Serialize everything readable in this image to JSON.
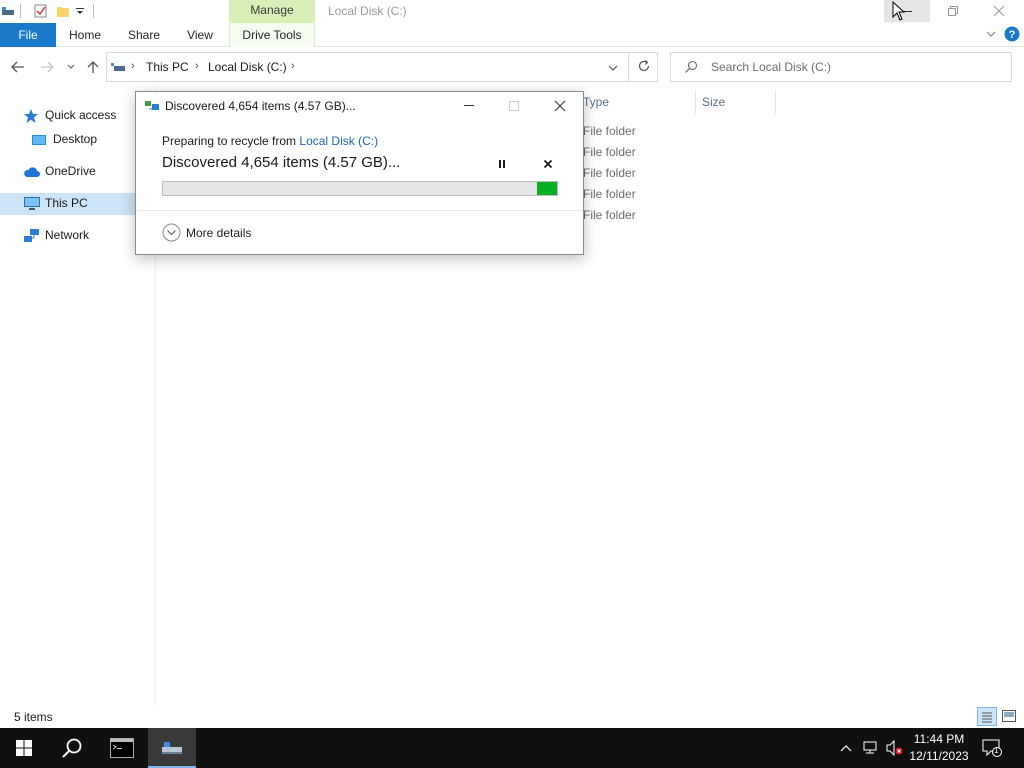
{
  "window": {
    "title": "Local Disk (C:)"
  },
  "ribbon": {
    "context_group": "Manage",
    "tabs": [
      {
        "label": "File"
      },
      {
        "label": "Home"
      },
      {
        "label": "Share"
      },
      {
        "label": "View"
      },
      {
        "label": "Drive Tools"
      }
    ]
  },
  "address": {
    "breadcrumb": [
      "This PC",
      "Local Disk (C:)"
    ],
    "search_placeholder": "Search Local Disk (C:)"
  },
  "nav": {
    "items": [
      {
        "label": "Quick access",
        "icon": "star-icon"
      },
      {
        "label": "Desktop",
        "icon": "desktop-folder-icon"
      },
      {
        "label": "OneDrive",
        "icon": "cloud-icon"
      },
      {
        "label": "This PC",
        "icon": "computer-icon",
        "selected": true
      },
      {
        "label": "Network",
        "icon": "network-icon"
      }
    ]
  },
  "content": {
    "columns": [
      "Type",
      "Size"
    ],
    "rows": [
      {
        "type": "File folder"
      },
      {
        "type": "File folder"
      },
      {
        "type": "File folder"
      },
      {
        "type": "File folder"
      },
      {
        "type": "File folder"
      }
    ]
  },
  "status": {
    "item_count": "5 items"
  },
  "dialog": {
    "title": "Discovered 4,654 items (4.57 GB)...",
    "subtitle_prefix": "Preparing to recycle from ",
    "subtitle_link": "Local Disk (C:)",
    "headline": "Discovered 4,654 items (4.57 GB)...",
    "progress": 0.05,
    "more_details": "More details",
    "progress_color": "#06b025"
  },
  "taskbar": {
    "time": "11:44 PM",
    "date": "12/11/2023",
    "notification_count": "1"
  },
  "colors": {
    "accent": "#1979ca",
    "manage_tab": "#d8f0b8",
    "taskbar": "#101010"
  }
}
